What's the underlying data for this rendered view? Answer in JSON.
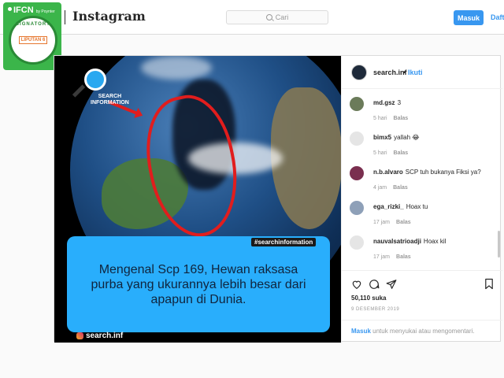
{
  "header": {
    "wordmark": "Instagram",
    "search_placeholder": "Cari",
    "login_button": "Masuk",
    "signup_link": "Daftar"
  },
  "badge": {
    "ifcn": "IFCN",
    "ifcn_sub": "by Poynter",
    "signatory": "SIGNATORY",
    "partner": "LIPUTAN 6"
  },
  "post": {
    "image": {
      "search_label_1": "SEARCH",
      "search_label_2": "INFORMATION",
      "hashtag": "#searchinformation",
      "caption": "Mengenal Scp 169, Hewan raksasa purba yang ukurannya lebih besar dari apapun di Dunia.",
      "handle": "search.inf"
    },
    "author": {
      "username": "search.inf",
      "separator": "•",
      "follow": "Ikuti"
    },
    "comments": [
      {
        "user": "md.gsz",
        "text": "3",
        "time": "5 hari",
        "reply": "Balas",
        "avatar_color": "#6b7b5a"
      },
      {
        "user": "bimx5",
        "text": "yallah 😂",
        "time": "5 hari",
        "reply": "Balas",
        "avatar_color": "#e5e5e5"
      },
      {
        "user": "n.b.alvaro",
        "text": "SCP tuh bukanya Fiksi ya?",
        "time": "4 jam",
        "reply": "Balas",
        "avatar_color": "#7a2f4f"
      },
      {
        "user": "ega_rizki_",
        "text": "Hoax tu",
        "time": "17 jam",
        "reply": "Balas",
        "avatar_color": "#8ea0b8"
      },
      {
        "user": "nauvalsatrioadji",
        "text": "Hoax kil",
        "time": "17 jam",
        "reply": "Balas",
        "avatar_color": "#e5e5e5"
      }
    ],
    "likes": "50,110 suka",
    "date": "9 DESEMBER 2019",
    "login_prompt_link": "Masuk",
    "login_prompt_text": "untuk menyukai atau mengomentari."
  }
}
